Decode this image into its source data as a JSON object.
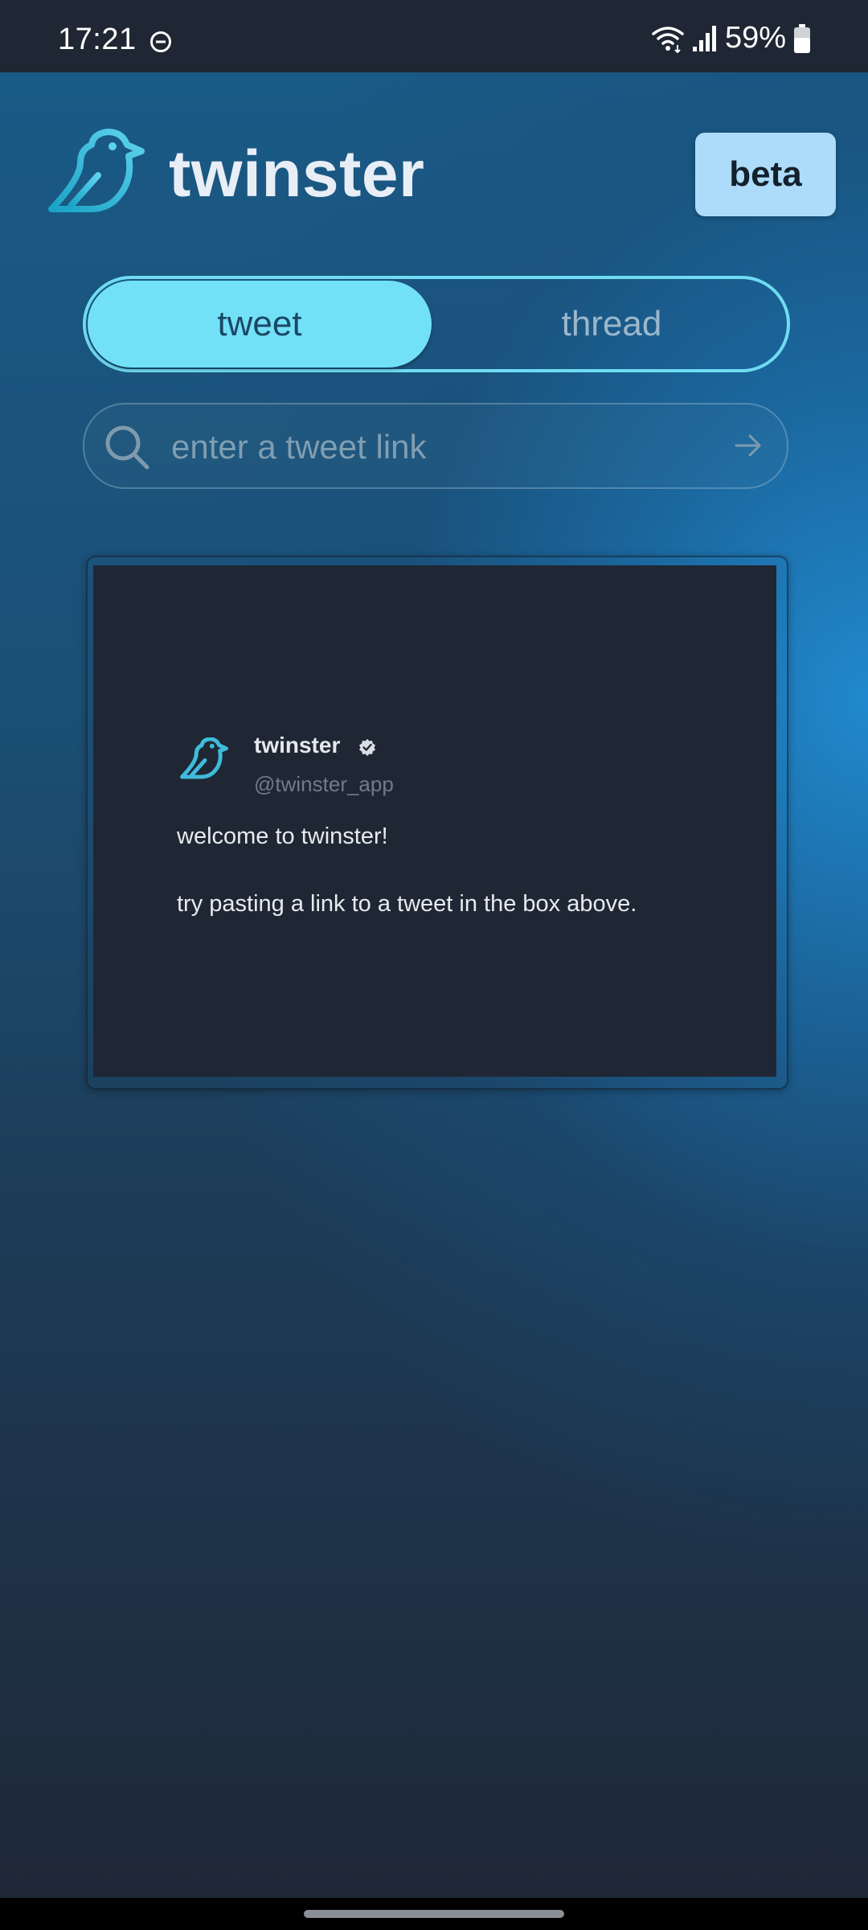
{
  "status_bar": {
    "time": "17:21",
    "battery_percent": "59%",
    "icons": [
      "do-not-disturb-icon",
      "wifi-icon",
      "signal-icon",
      "battery-icon"
    ],
    "battery_level": 0.59
  },
  "header": {
    "title": "twinster",
    "beta_label": "beta",
    "logo_icon": "bird-logo-icon"
  },
  "mode_toggle": {
    "options": [
      "tweet",
      "thread"
    ],
    "selected": "tweet"
  },
  "search": {
    "placeholder": "enter a tweet link",
    "value": "",
    "icon": "search-icon",
    "submit_icon": "arrow-right-icon"
  },
  "preview_card": {
    "name": "twinster",
    "handle": "@twinster_app",
    "verified": true,
    "line1": "welcome to twinster!",
    "line2": "try pasting a link to a tweet in the box above."
  },
  "colors": {
    "accent": "#72e1f8",
    "beta_bg": "#acdcf9",
    "card_bg": "#1f2734",
    "title_text": "#e8eef5"
  }
}
